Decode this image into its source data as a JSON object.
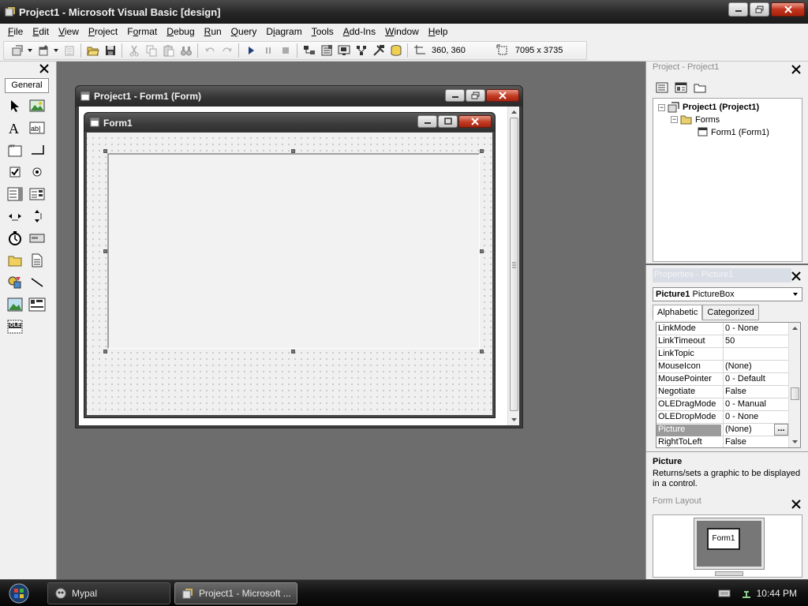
{
  "window": {
    "title": "Project1 - Microsoft Visual Basic [design]"
  },
  "menu": [
    {
      "label": "File",
      "key": "F",
      "rest": "ile"
    },
    {
      "label": "Edit",
      "key": "E",
      "rest": "dit"
    },
    {
      "label": "View",
      "key": "V",
      "rest": "iew"
    },
    {
      "label": "Project",
      "key": "P",
      "rest": "roject"
    },
    {
      "label": "Format",
      "key": "o",
      "pre": "F",
      "rest": "rmat"
    },
    {
      "label": "Debug",
      "key": "D",
      "rest": "ebug"
    },
    {
      "label": "Run",
      "key": "R",
      "rest": "un"
    },
    {
      "label": "Query",
      "key": "Q",
      "rest": "uery"
    },
    {
      "label": "Diagram",
      "key": "i",
      "pre": "D",
      "rest": "agram"
    },
    {
      "label": "Tools",
      "key": "T",
      "rest": "ools"
    },
    {
      "label": "Add-Ins",
      "key": "A",
      "rest": "dd-Ins"
    },
    {
      "label": "Window",
      "key": "W",
      "rest": "indow"
    },
    {
      "label": "Help",
      "key": "H",
      "rest": "elp"
    }
  ],
  "toolbar": {
    "position_readout": "360, 360",
    "size_readout": "7095 x 3735"
  },
  "toolbox": {
    "tab_label": "General",
    "tools": [
      "pointer-icon",
      "picturebox-icon",
      "label-icon",
      "textbox-icon",
      "frame-icon",
      "commandbutton-icon",
      "checkbox-icon",
      "optionbutton-icon",
      "combobox-icon",
      "listbox-icon",
      "hscrollbar-icon",
      "vscrollbar-icon",
      "timer-icon",
      "drivelistbox-icon",
      "dirlistbox-icon",
      "filelistbox-icon",
      "shape-icon",
      "line-icon",
      "image-icon",
      "data-icon",
      "ole-icon"
    ],
    "ole_label": "OLE"
  },
  "designer": {
    "title": "Project1 - Form1 (Form)",
    "form_title": "Form1"
  },
  "project_explorer": {
    "title": "Project - Project1",
    "root": "Project1 (Project1)",
    "folder": "Forms",
    "item": "Form1 (Form1)"
  },
  "properties": {
    "title": "Properties - Picture1",
    "object_name": "Picture1",
    "object_type": "PictureBox",
    "tabs": [
      "Alphabetic",
      "Categorized"
    ],
    "rows": [
      {
        "name": "LinkMode",
        "value": "0 - None"
      },
      {
        "name": "LinkTimeout",
        "value": "50"
      },
      {
        "name": "LinkTopic",
        "value": ""
      },
      {
        "name": "MouseIcon",
        "value": "(None)"
      },
      {
        "name": "MousePointer",
        "value": "0 - Default"
      },
      {
        "name": "Negotiate",
        "value": "False"
      },
      {
        "name": "OLEDragMode",
        "value": "0 - Manual"
      },
      {
        "name": "OLEDropMode",
        "value": "0 - None"
      },
      {
        "name": "Picture",
        "value": "(None)"
      },
      {
        "name": "RightToLeft",
        "value": "False"
      }
    ],
    "selected_row": "Picture",
    "ellipsis_label": "...",
    "description_title": "Picture",
    "description_text": "Returns/sets a graphic to be displayed in a control."
  },
  "form_layout": {
    "title": "Form Layout",
    "mini_form_label": "Form1"
  },
  "taskbar": {
    "items": [
      {
        "label": "Mypal",
        "active": false
      },
      {
        "label": "Project1 - Microsoft ...",
        "active": true
      }
    ],
    "clock": "10:44 PM"
  },
  "colors": {
    "workspace": "#6d6d6d",
    "panel": "#f0f0f0",
    "titlebar": "#262626",
    "close_button": "#c4331c"
  }
}
